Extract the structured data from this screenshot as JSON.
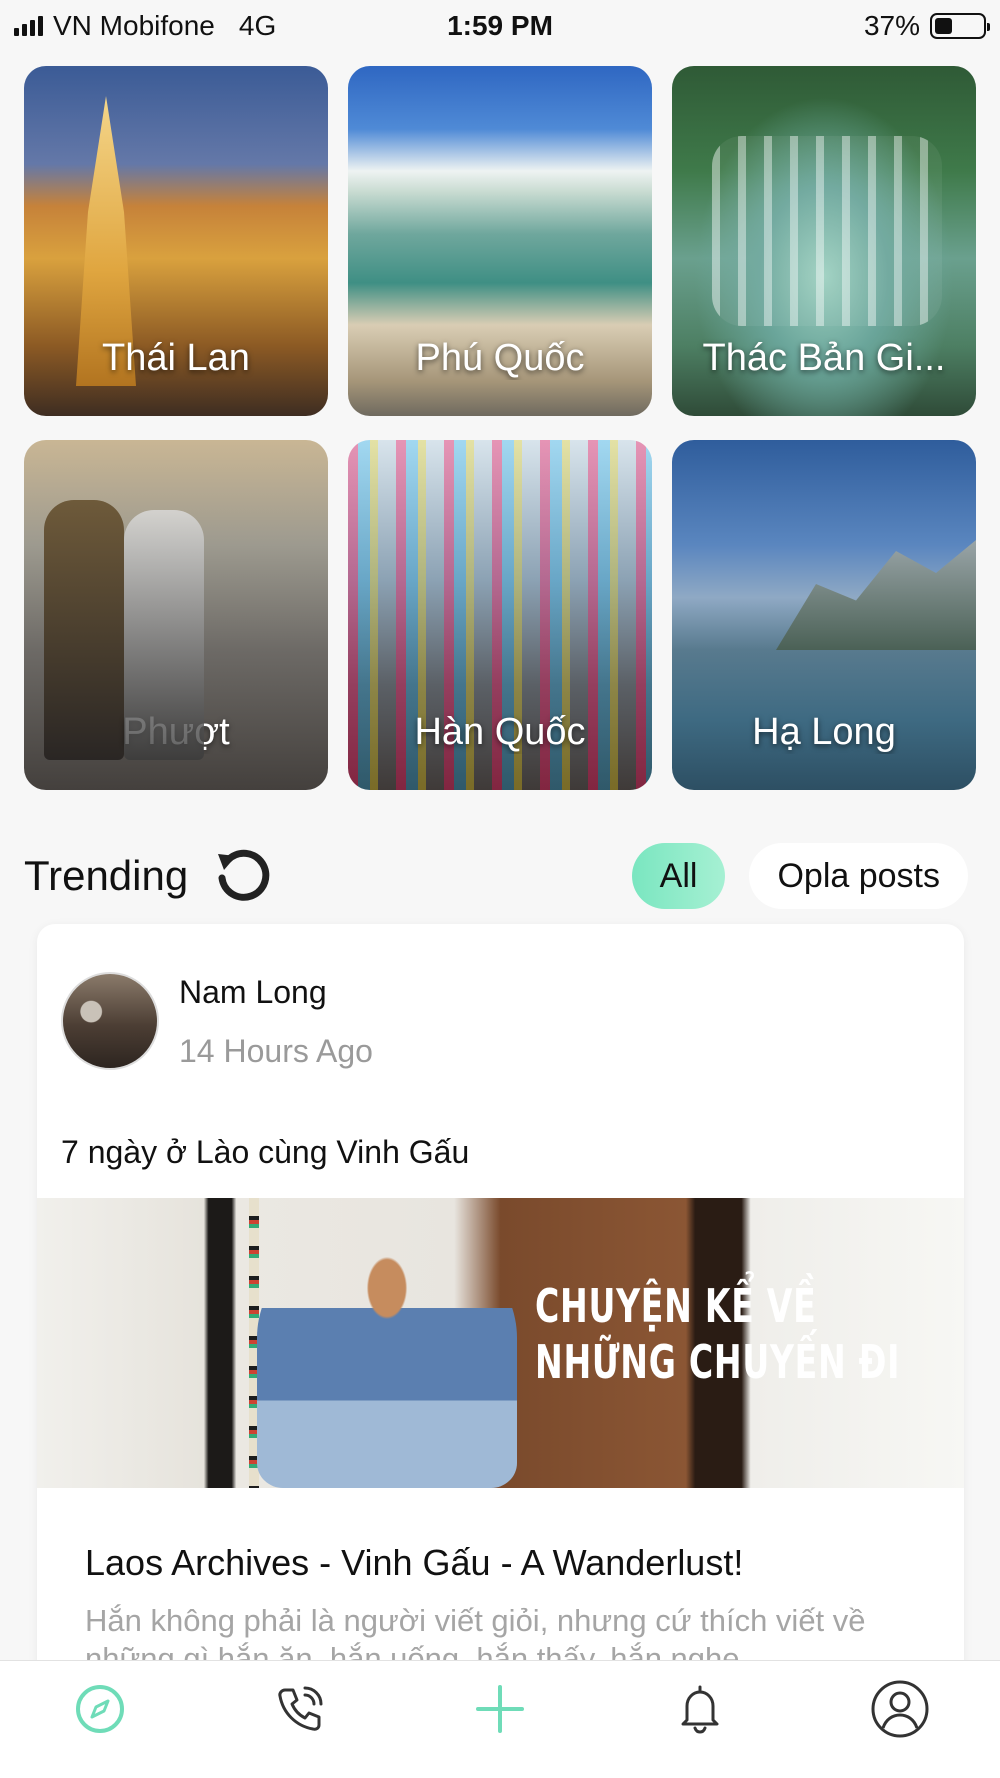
{
  "status_bar": {
    "carrier": "VN Mobifone",
    "network": "4G",
    "time": "1:59 PM",
    "battery": "37%",
    "battery_level": 0.37
  },
  "destinations": [
    {
      "label": "Thái Lan"
    },
    {
      "label": "Phú Quốc"
    },
    {
      "label": "Thác Bản Gi..."
    },
    {
      "label": "Phượt"
    },
    {
      "label": "Hàn Quốc"
    },
    {
      "label": "Hạ Long"
    }
  ],
  "trending": {
    "title": "Trending",
    "filters": [
      {
        "label": "All",
        "active": true
      },
      {
        "label": "Opla posts",
        "active": false
      }
    ]
  },
  "post": {
    "author": "Nam Long",
    "time": "14 Hours Ago",
    "caption": "7 ngày ở Lào cùng Vinh Gấu",
    "image_text_line1": "CHUYỆN KỂ VỀ",
    "image_text_line2": "NHỮNG CHUYẾN ĐI",
    "title": "Laos Archives - Vinh Gấu - A Wanderlust!",
    "excerpt": "Hắn không phải là người viết giỏi, nhưng cứ thích viết về những gì hắn ăn, hắn uống, hắn thấy, hắn nghe,....."
  },
  "colors": {
    "accent": "#7ae6c0",
    "accent_icon": "#6fdcb8"
  },
  "bottom_nav": [
    {
      "icon": "compass-icon",
      "active": true
    },
    {
      "icon": "phone-icon",
      "active": false
    },
    {
      "icon": "plus-icon",
      "active": false
    },
    {
      "icon": "bell-icon",
      "active": false
    },
    {
      "icon": "profile-icon",
      "active": false
    }
  ]
}
